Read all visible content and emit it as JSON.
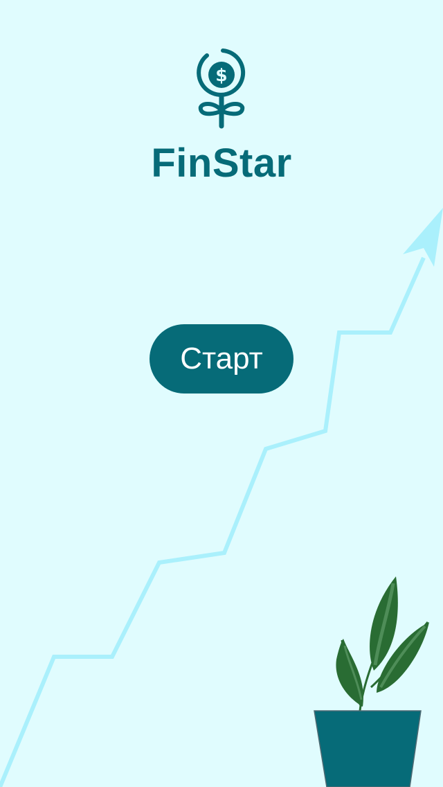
{
  "app": {
    "title": "FinStar",
    "logo_icon": "money-flower-icon"
  },
  "start_button": {
    "label": "Старт"
  },
  "decorations": {
    "growth_arrow": "growth-arrow-icon",
    "plant": "potted-plant-icon"
  },
  "colors": {
    "background": "#e0fcfe",
    "accent": "#066b78",
    "growth_line": "#aaf0fc",
    "leaf_dark": "#296c33",
    "leaf_light": "#4e8d58"
  }
}
